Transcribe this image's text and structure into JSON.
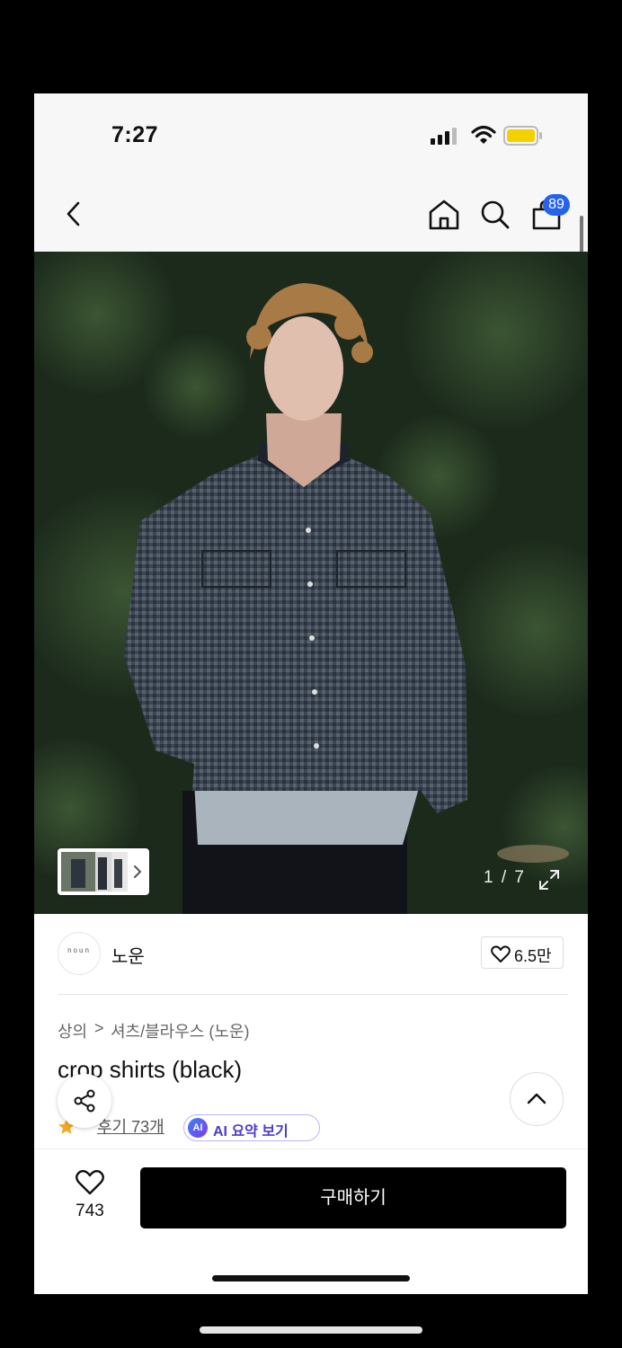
{
  "status_bar": {
    "time": "7:27"
  },
  "nav": {
    "cart_count": "89"
  },
  "gallery": {
    "counter": "1 / 7"
  },
  "brand": {
    "logo_text": "noun",
    "name": "노운",
    "likes": "6.5만"
  },
  "breadcrumb": {
    "cat1": "상의",
    "sep": ">",
    "cat2": "셔츠/블라우스 (노운)"
  },
  "product": {
    "title": "crop shirts (black)"
  },
  "reviews": {
    "link": "후기 73개",
    "ai_badge": "AI",
    "ai_label": "AI 요약 보기"
  },
  "bottom": {
    "wish_count": "743",
    "buy_label": "구매하기"
  },
  "colors": {
    "accent_blue": "#2563eb",
    "battery": "#f4d000",
    "ai_purple": "#4b3cc9"
  }
}
